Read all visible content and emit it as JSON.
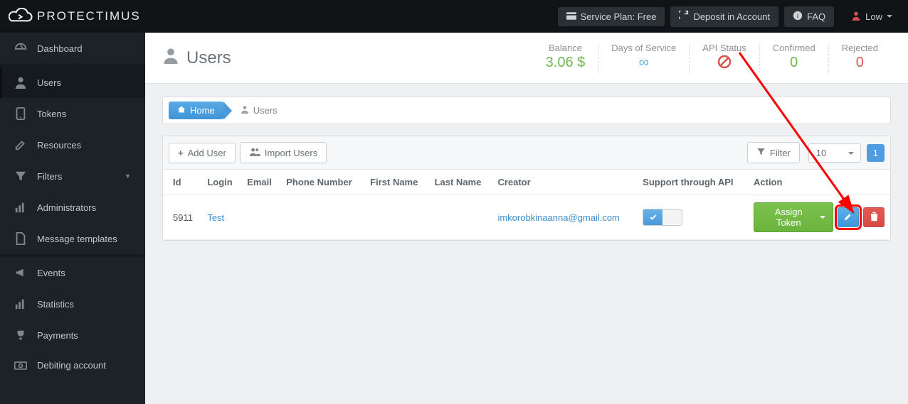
{
  "brand": "PROTECTIMUS",
  "navbar": {
    "service_plan": "Service Plan: Free",
    "deposit": "Deposit in Account",
    "faq": "FAQ",
    "user": "Low"
  },
  "sidebar": {
    "items": [
      {
        "label": "Dashboard"
      },
      {
        "label": "Users"
      },
      {
        "label": "Tokens"
      },
      {
        "label": "Resources"
      },
      {
        "label": "Filters"
      },
      {
        "label": "Administrators"
      },
      {
        "label": "Message templates"
      },
      {
        "label": "Events"
      },
      {
        "label": "Statistics"
      },
      {
        "label": "Payments"
      },
      {
        "label": "Debiting account"
      }
    ]
  },
  "page": {
    "title": "Users",
    "stats": {
      "balance_lbl": "Balance",
      "balance_val": "3.06 $",
      "days_lbl": "Days of Service",
      "days_val": "∞",
      "api_lbl": "API Status",
      "confirmed_lbl": "Confirmed",
      "confirmed_val": "0",
      "rejected_lbl": "Rejected",
      "rejected_val": "0"
    }
  },
  "breadcrumb": {
    "home": "Home",
    "current": "Users"
  },
  "toolbar": {
    "add_user": "Add User",
    "import_users": "Import Users",
    "filter": "Filter",
    "page_size": "10",
    "page_num": "1"
  },
  "table": {
    "headers": [
      "Id",
      "Login",
      "Email",
      "Phone Number",
      "First Name",
      "Last Name",
      "Creator",
      "Support through API",
      "Action"
    ],
    "rows": [
      {
        "id": "5911",
        "login": "Test",
        "email": "",
        "phone": "",
        "first": "",
        "last": "",
        "creator": "imkorobkinaanna@gmail.com",
        "api_on": true
      }
    ],
    "assign_label": "Assign Token"
  }
}
